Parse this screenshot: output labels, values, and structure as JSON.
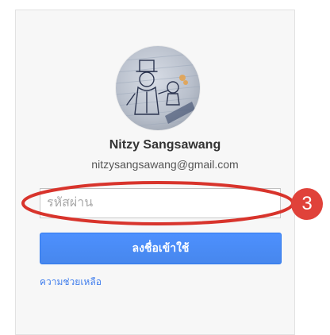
{
  "account": {
    "name": "Nitzy Sangsawang",
    "email": "nitzysangsawang@gmail.com",
    "avatar_icon": "sketch-avatar"
  },
  "password_field": {
    "placeholder": "รหัสผ่าน",
    "value": ""
  },
  "signin_button": {
    "label": "ลงชื่อเข้าใช้"
  },
  "help_link": {
    "label": "ความช่วยเหลือ"
  },
  "annotation": {
    "step_number": "3",
    "color": "#e0423a"
  },
  "colors": {
    "accent": "#4d90fe",
    "link": "#427fed",
    "card_bg": "#f7f7f7"
  }
}
